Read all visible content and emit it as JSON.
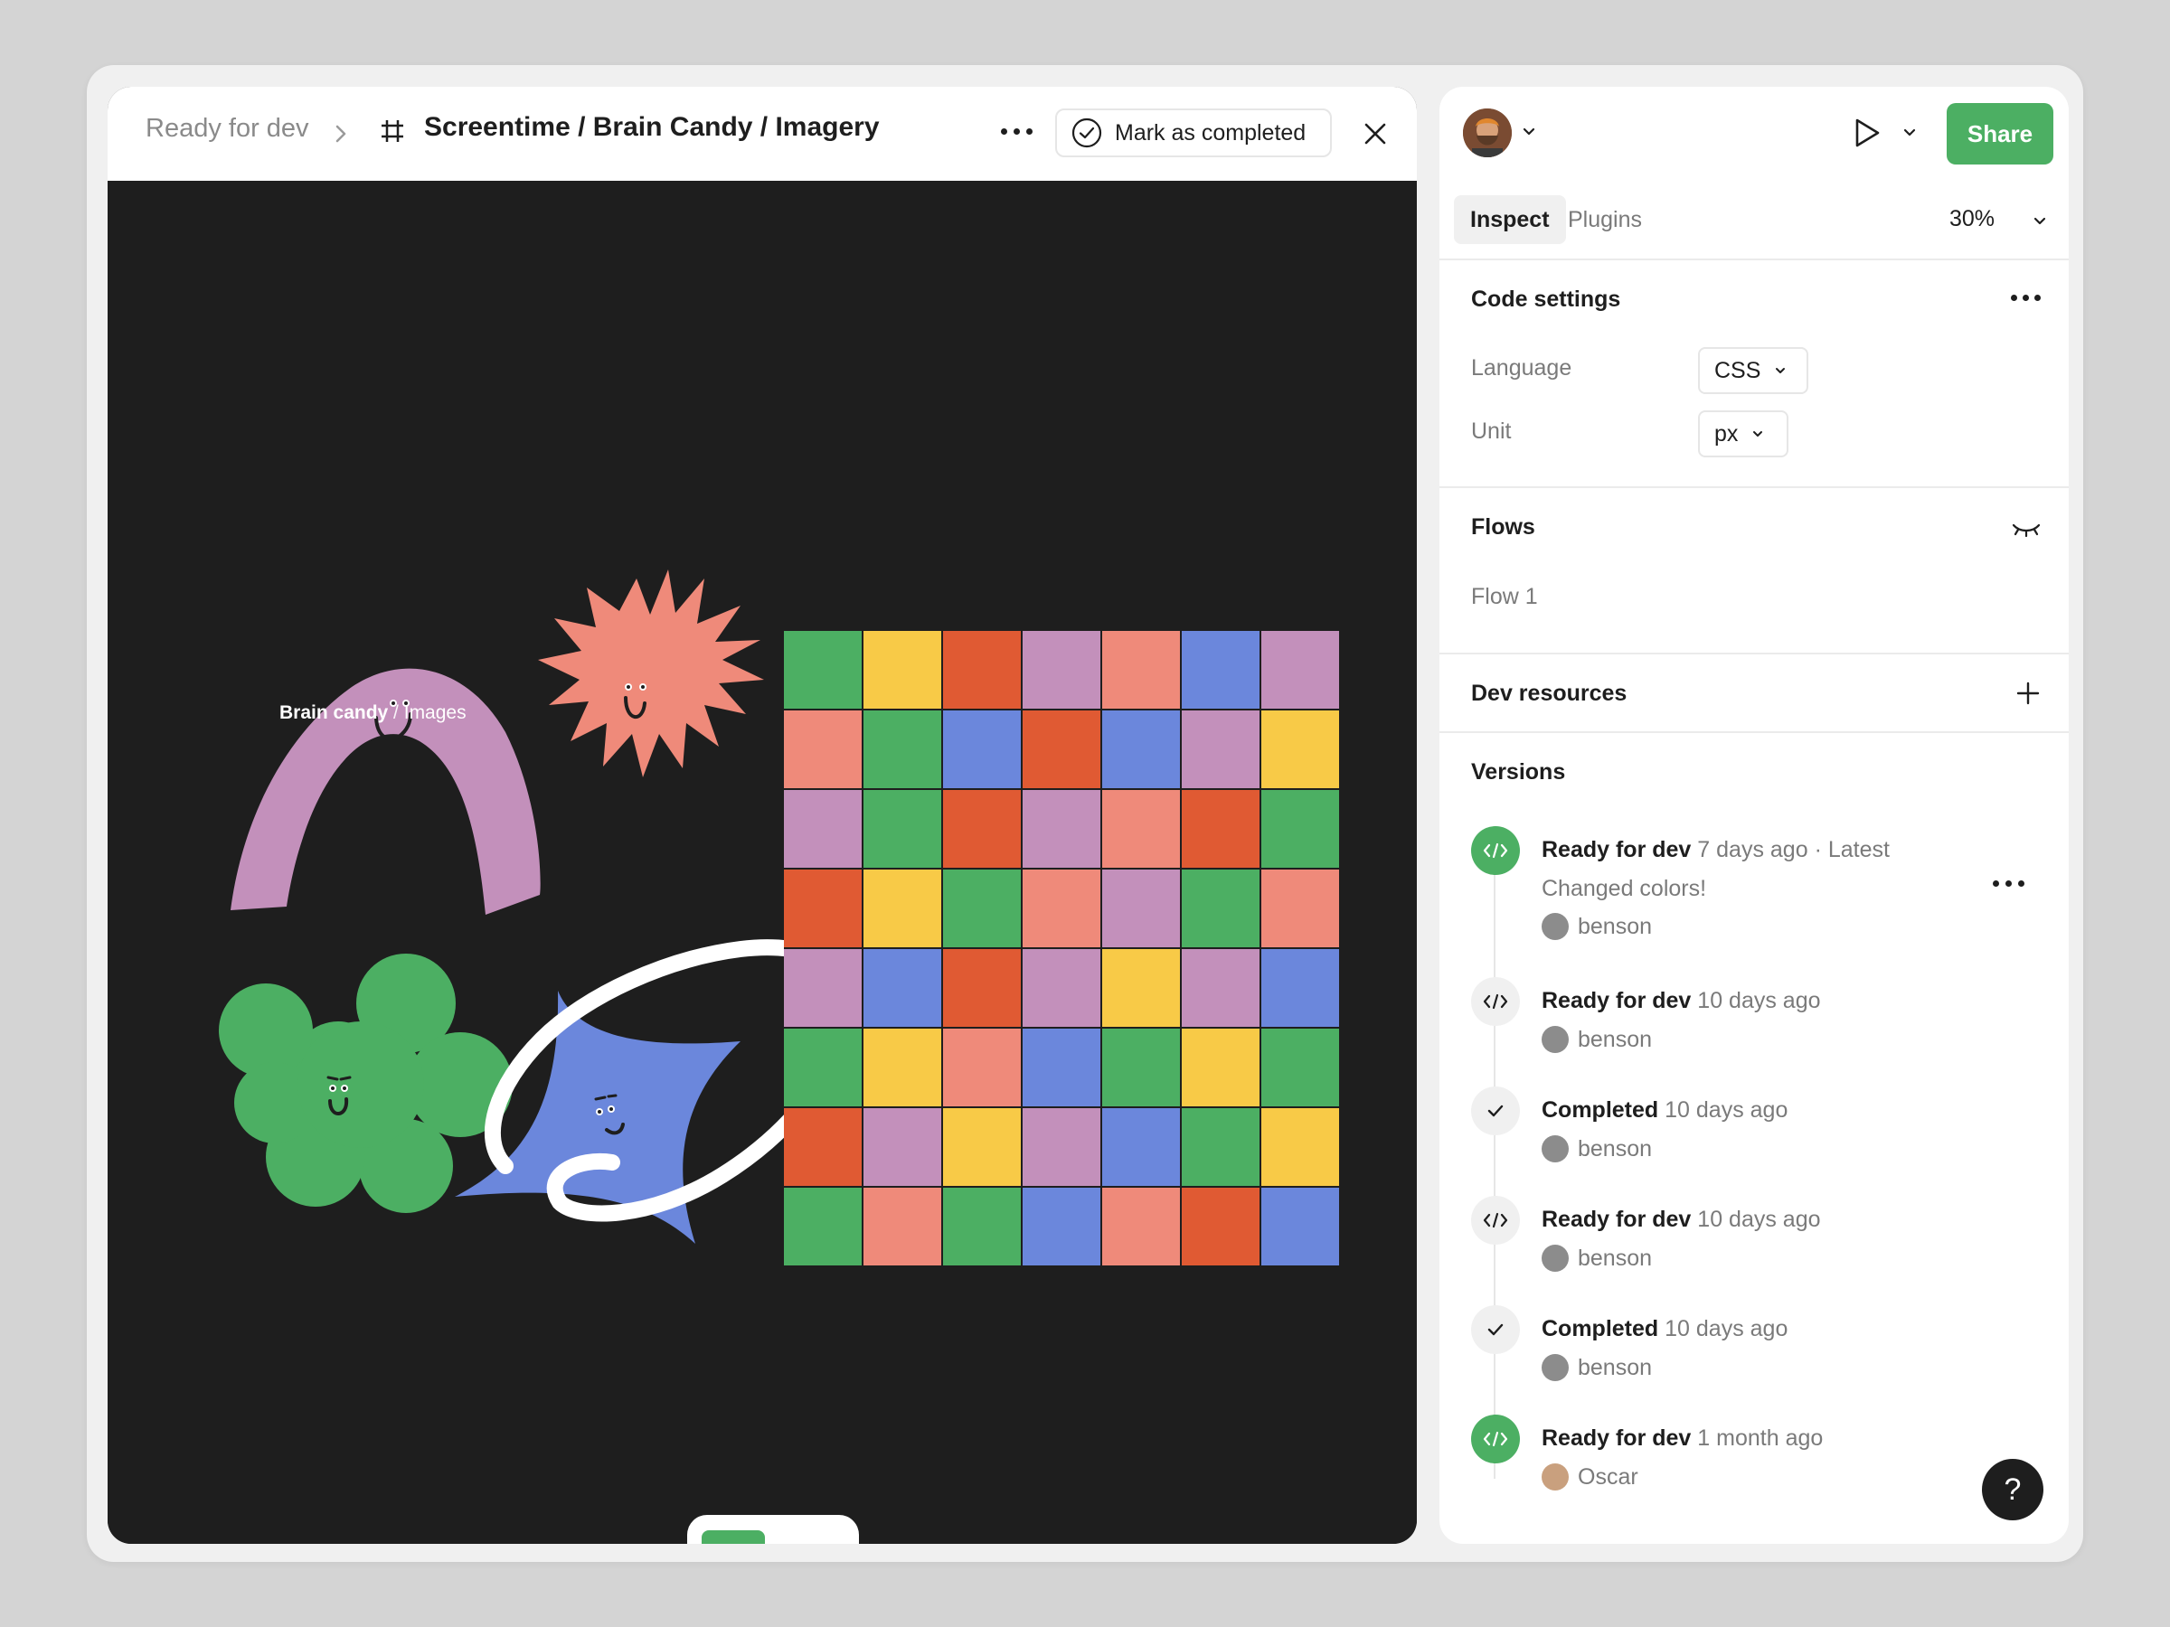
{
  "breadcrumb": {
    "status": "Ready for dev",
    "title": "Screentime / Brain Candy / Imagery"
  },
  "mark_completed_label": "Mark as completed",
  "canvas": {
    "label_bold": "Brain candy",
    "label_sep": " / ",
    "label_rest": "Images",
    "background": "#1e1e1e",
    "grid_colors": [
      [
        "#4caf63",
        "#f8ca47",
        "#e05a33",
        "#c390bb",
        "#ef8a7a",
        "#6b87dc",
        "#c390bb"
      ],
      [
        "#ef8a7a",
        "#4caf63",
        "#6b87dc",
        "#e05a33",
        "#6b87dc",
        "#c390bb",
        "#f8ca47"
      ],
      [
        "#c390bb",
        "#4caf63",
        "#e05a33",
        "#c390bb",
        "#ef8a7a",
        "#e05a33",
        "#4caf63"
      ],
      [
        "#e05a33",
        "#f8ca47",
        "#4caf63",
        "#ef8a7a",
        "#c390bb",
        "#4caf63",
        "#ef8a7a"
      ],
      [
        "#c390bb",
        "#6b87dc",
        "#e05a33",
        "#c390bb",
        "#f8ca47",
        "#c390bb",
        "#6b87dc"
      ],
      [
        "#4caf63",
        "#f8ca47",
        "#ef8a7a",
        "#6b87dc",
        "#4caf63",
        "#f8ca47",
        "#4caf63"
      ],
      [
        "#e05a33",
        "#c390bb",
        "#f8ca47",
        "#c390bb",
        "#6b87dc",
        "#4caf63",
        "#f8ca47"
      ],
      [
        "#4caf63",
        "#ef8a7a",
        "#4caf63",
        "#6b87dc",
        "#ef8a7a",
        "#e05a33",
        "#6b87dc"
      ]
    ]
  },
  "toolbar": {
    "move_icon": "cursor-arrow-icon",
    "comment_icon": "comment-bubble-icon"
  },
  "colors": {
    "accent": "#4caf63",
    "text": "#1e1e1e",
    "muted": "#7a7a7a"
  },
  "right_panel": {
    "share_label": "Share",
    "tabs": [
      {
        "label": "Inspect",
        "active": true
      },
      {
        "label": "Plugins",
        "active": false
      }
    ],
    "zoom": "30%",
    "code_settings": {
      "title": "Code settings",
      "language_label": "Language",
      "language_value": "CSS",
      "unit_label": "Unit",
      "unit_value": "px"
    },
    "flows": {
      "title": "Flows",
      "items": [
        "Flow 1"
      ]
    },
    "dev_resources": {
      "title": "Dev resources"
    },
    "versions": {
      "title": "Versions",
      "items": [
        {
          "status": "Ready for dev",
          "time": "7 days ago",
          "tag": " · Latest",
          "desc": "Changed colors!",
          "user": "benson",
          "icon": "code-icon",
          "highlight": true
        },
        {
          "status": "Ready for dev",
          "time": "10 days ago",
          "user": "benson",
          "icon": "code-icon",
          "highlight": false
        },
        {
          "status": "Completed",
          "time": "10 days ago",
          "user": "benson",
          "icon": "check-icon",
          "highlight": false
        },
        {
          "status": "Ready for dev",
          "time": "10 days ago",
          "user": "benson",
          "icon": "code-icon",
          "highlight": false
        },
        {
          "status": "Completed",
          "time": "10 days ago",
          "user": "benson",
          "icon": "check-icon",
          "highlight": false
        },
        {
          "status": "Ready for dev",
          "time": "1 month ago",
          "user": "Oscar",
          "icon": "code-icon",
          "highlight": true
        }
      ]
    },
    "help_label": "?"
  }
}
